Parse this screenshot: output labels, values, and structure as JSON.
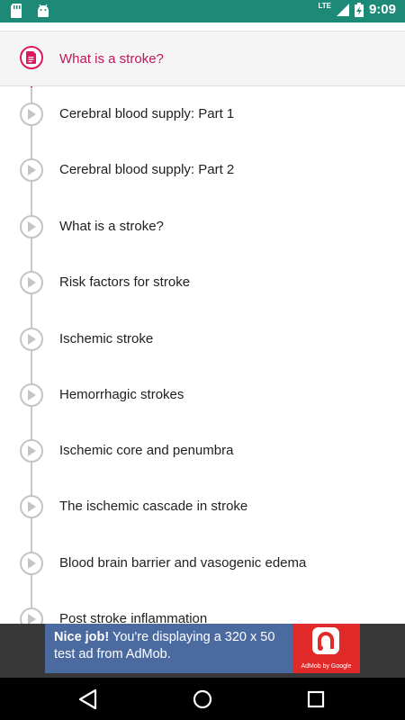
{
  "status_bar": {
    "time": "9:09",
    "network": "LTE",
    "battery_level": "charging",
    "left_icons": [
      "sd-card-icon",
      "android-icon"
    ],
    "background_color": "#1d8a78"
  },
  "lessons": {
    "accent_color": "#d81b60",
    "active_index": 0,
    "items": [
      {
        "label": "What is a stroke?",
        "type": "article",
        "active": true
      },
      {
        "label": "Cerebral blood supply: Part 1",
        "type": "video",
        "active": false
      },
      {
        "label": "Cerebral blood supply: Part 2",
        "type": "video",
        "active": false
      },
      {
        "label": "What is a stroke?",
        "type": "video",
        "active": false
      },
      {
        "label": "Risk factors for stroke",
        "type": "video",
        "active": false
      },
      {
        "label": "Ischemic stroke",
        "type": "video",
        "active": false
      },
      {
        "label": "Hemorrhagic strokes",
        "type": "video",
        "active": false
      },
      {
        "label": "Ischemic core and penumbra",
        "type": "video",
        "active": false
      },
      {
        "label": "The ischemic cascade in stroke",
        "type": "video",
        "active": false
      },
      {
        "label": "Blood brain barrier and vasogenic edema",
        "type": "video",
        "active": false
      },
      {
        "label": "Post stroke inflammation",
        "type": "video",
        "active": false
      }
    ]
  },
  "ad": {
    "headline": "Nice job!",
    "body": "You're displaying a 320 x 50 test ad from AdMob.",
    "brand": "AdMob by Google",
    "background_color": "#4b6aa0",
    "logo_color": "#e02a2a"
  },
  "nav_bar": {
    "buttons": [
      "back-icon",
      "home-icon",
      "recents-icon"
    ]
  }
}
